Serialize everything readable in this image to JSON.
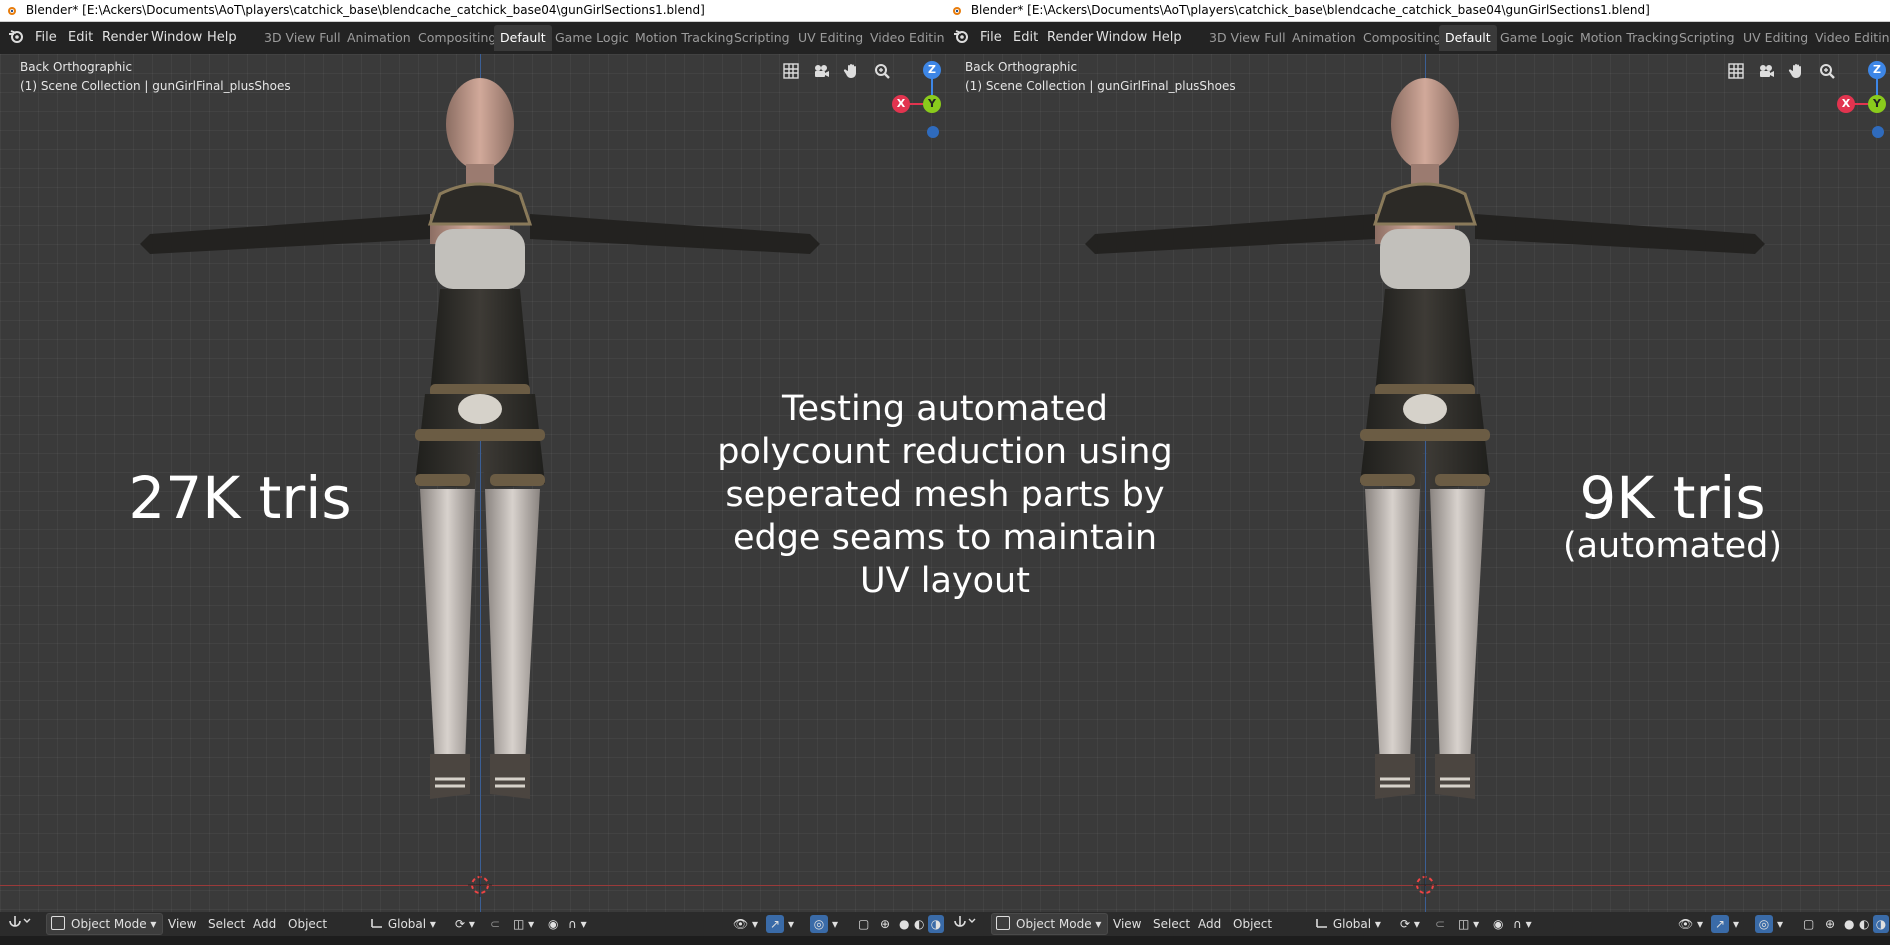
{
  "window": {
    "title": "Blender* [E:\\Ackers\\Documents\\AoT\\players\\catchick_base\\blendcache_catchick_base04\\gunGirlSections1.blend]"
  },
  "menu": [
    "File",
    "Edit",
    "Render",
    "Window",
    "Help"
  ],
  "workspaces": [
    "3D View Full",
    "Animation",
    "Compositing",
    "Default",
    "Game Logic",
    "Motion Tracking",
    "Scripting",
    "UV Editing",
    "Video Editing"
  ],
  "active_workspace": "Default",
  "viewport": {
    "view_name": "Back Orthographic",
    "collection": "(1) Scene Collection | gunGirlFinal_plusShoes"
  },
  "gizmo": {
    "z": "Z",
    "x": "X",
    "y": "Y"
  },
  "header": {
    "mode": "Object Mode",
    "view": "View",
    "select": "Select",
    "add": "Add",
    "object": "Object",
    "orientation": "Global"
  },
  "overlay": {
    "left_label": "27K tris",
    "center_text": [
      "Testing automated",
      "polycount reduction using",
      "seperated mesh parts by",
      "edge seams to maintain",
      "UV layout"
    ],
    "right_label": "9K tris",
    "right_sub": "(automated)"
  },
  "colors": {
    "x_axis": "#e2344f",
    "y_axis": "#8acb1c",
    "z_axis": "#3d86e6",
    "active_ws": "#3a3a3a"
  }
}
